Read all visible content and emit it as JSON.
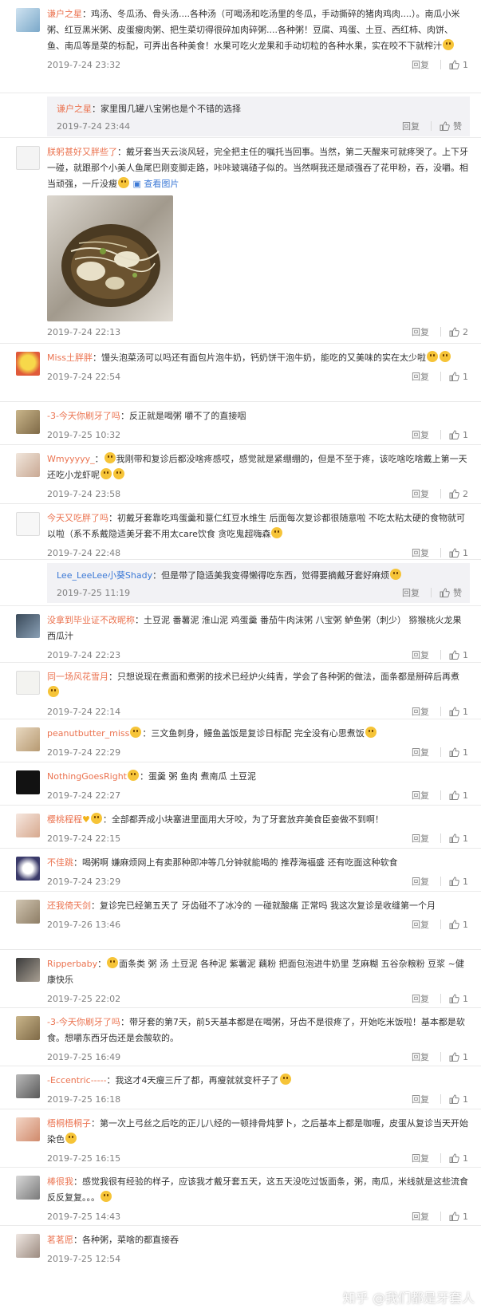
{
  "labels": {
    "reply": "回复",
    "like": "赞",
    "view_pic": "查看图片"
  },
  "comments": [
    {
      "user": "谦户之星",
      "text": "鸡汤、冬瓜汤、骨头汤....各种汤（可喝汤和吃汤里的冬瓜，手动撕碎的猪肉鸡肉....）。南瓜小米粥、红豆黑米粥、皮蛋瘦肉粥、把生菜切得很碎加肉碎粥....各种粥！豆腐、鸡蛋、土豆、西红柿、肉饼、鱼、南瓜等是菜的标配，可弄出各种美食！水果可吃火龙果和手动切粒的各种水果，实在咬不下就榨汁",
      "time": "2019-7-24 23:32",
      "likes": "1"
    },
    {
      "user": "谦户之星",
      "text": "家里囤几罐八宝粥也是个不错的选择",
      "time": "2019-7-24 23:44",
      "likes": "赞"
    },
    {
      "user": "朕躬甚好又胖些了",
      "text": "戴牙套当天云淡风轻，完全把主任的嘱托当回事。当然，第二天醒来可就疼哭了。上下牙一碰，就跟那个小美人鱼尾巴刚变脚走路，咔咔玻璃碴子似的。当然啊我还是顽强吞了花甲粉，吞，没嚼。相当顽强，一斤没瘦",
      "time": "2019-7-24 22:13",
      "likes": "2"
    },
    {
      "user": "Miss土胖胖",
      "text": "馒头泡菜汤可以吗还有面包片泡牛奶，钙奶饼干泡牛奶，能吃的又美味的实在太少啦",
      "time": "2019-7-24 22:54",
      "likes": "1"
    },
    {
      "user": "-3-今天你刷牙了吗",
      "text": "反正就是喝粥 嚼不了的直接咽",
      "time": "2019-7-25 10:32",
      "likes": "1"
    },
    {
      "user": "Wmyyyyy_",
      "text": "我刚带和复诊后都没啥疼感哎，感觉就是紧绷绷的，但是不至于疼，该吃啥吃啥戴上第一天还吃小龙虾呢",
      "time": "2019-7-24 23:58",
      "likes": "2"
    },
    {
      "user": "今天又吃胖了吗",
      "text": "初戴牙套靠吃鸡蛋羹和薏仁红豆水维生 后面每次复诊都很随意啦  不吃太粘太硬的食物就可以啦（系不系戴隐适美牙套不用太care饮食 贪吃鬼超嗨森",
      "time": "2019-7-24 22:48",
      "likes": "1"
    },
    {
      "user": "Lee_LeeLee小葵Shady",
      "text": "但是带了隐适美我变得懒得吃东西，觉得要摘戴牙套好麻烦",
      "time": "2019-7-25 11:19",
      "likes": "赞"
    },
    {
      "user": "没拿到毕业证不改昵称",
      "text": "土豆泥  番薯泥  淮山泥  鸡蛋羹  番茄牛肉沫粥  八宝粥  鲈鱼粥（刺少） 猕猴桃火龙果西瓜汁",
      "time": "2019-7-24 22:23",
      "likes": "1"
    },
    {
      "user": "同一场风花雪月",
      "text": "只想说现在煮面和煮粥的技术已经炉火纯青，学会了各种粥的做法，面条都是掰碎后再煮",
      "time": "2019-7-24 22:14",
      "likes": "1"
    },
    {
      "user": "peanutbutter_miss",
      "text": "三文鱼刺身，鳗鱼盖饭是复诊日标配 完全没有心思煮饭",
      "time": "2019-7-24 22:29",
      "likes": "1"
    },
    {
      "user": "NothingGoesRight",
      "text": "蛋羹  粥  鱼肉  煮南瓜  土豆泥",
      "time": "2019-7-24 22:27",
      "likes": "1"
    },
    {
      "user": "樱桃程程",
      "text": "全部都弄成小块塞进里面用大牙咬，为了牙套放弃美食臣妾做不到啊！",
      "time": "2019-7-24 22:15",
      "likes": "1"
    },
    {
      "user": "不佳跳",
      "text": "喝粥啊 嫌麻烦网上有卖那种即冲等几分钟就能喝的  推荐海福盛  还有吃面这种软食",
      "time": "2019-7-24 23:29",
      "likes": "1"
    },
    {
      "user": "还我倚天剑",
      "text": "复诊完已经第五天了 牙齿碰不了冰冷的 一碰就酸痛 正常吗 我这次复诊是收缝第一个月",
      "time": "2019-7-26 13:46",
      "likes": "1"
    },
    {
      "user": "Ripperbaby",
      "text": "面条类 粥 汤 土豆泥 各种泥 紫薯泥 藕粉 把面包泡进牛奶里 芝麻糊 五谷杂粮粉 豆浆 ~健康快乐",
      "time": "2019-7-25 22:02",
      "likes": "1"
    },
    {
      "user": "-3-今天你刷牙了吗",
      "text": "带牙套的第7天，前5天基本都是在喝粥，牙齿不是很疼了，开始吃米饭啦！基本都是软食。想嚼东西牙齿还是会酸软的。",
      "time": "2019-7-25 16:49",
      "likes": "1"
    },
    {
      "user": "-Eccentric-----",
      "text": "我这才4天瘦三斤了都，再瘦就就变杆子了",
      "time": "2019-7-25 16:18",
      "likes": "1"
    },
    {
      "user": "梧桐梧桐子",
      "text": "第一次上弓丝之后吃的正儿八经的一顿排骨炖萝卜，之后基本上都是咖喱，皮蛋从复诊当天开始染色",
      "time": "2019-7-25 16:15",
      "likes": "1"
    },
    {
      "user": "棒很我",
      "text": "感觉我很有经验的样子，应该我才戴牙套五天，这五天没吃过饭面条，粥，南瓜，米线就是这些流食反反复复。。。",
      "time": "2019-7-25 14:43",
      "likes": "1"
    },
    {
      "user": "茗茗愿",
      "text": "各种粥，菜啥的都直接吞",
      "time": "2019-7-25 12:54",
      "likes": ""
    }
  ],
  "watermark": "知乎 @我们都是牙套人",
  "colors": {
    "username": "#eb7350",
    "link": "#3d7ad6",
    "meta": "#808080",
    "subreply_bg": "#f2f2f5"
  }
}
